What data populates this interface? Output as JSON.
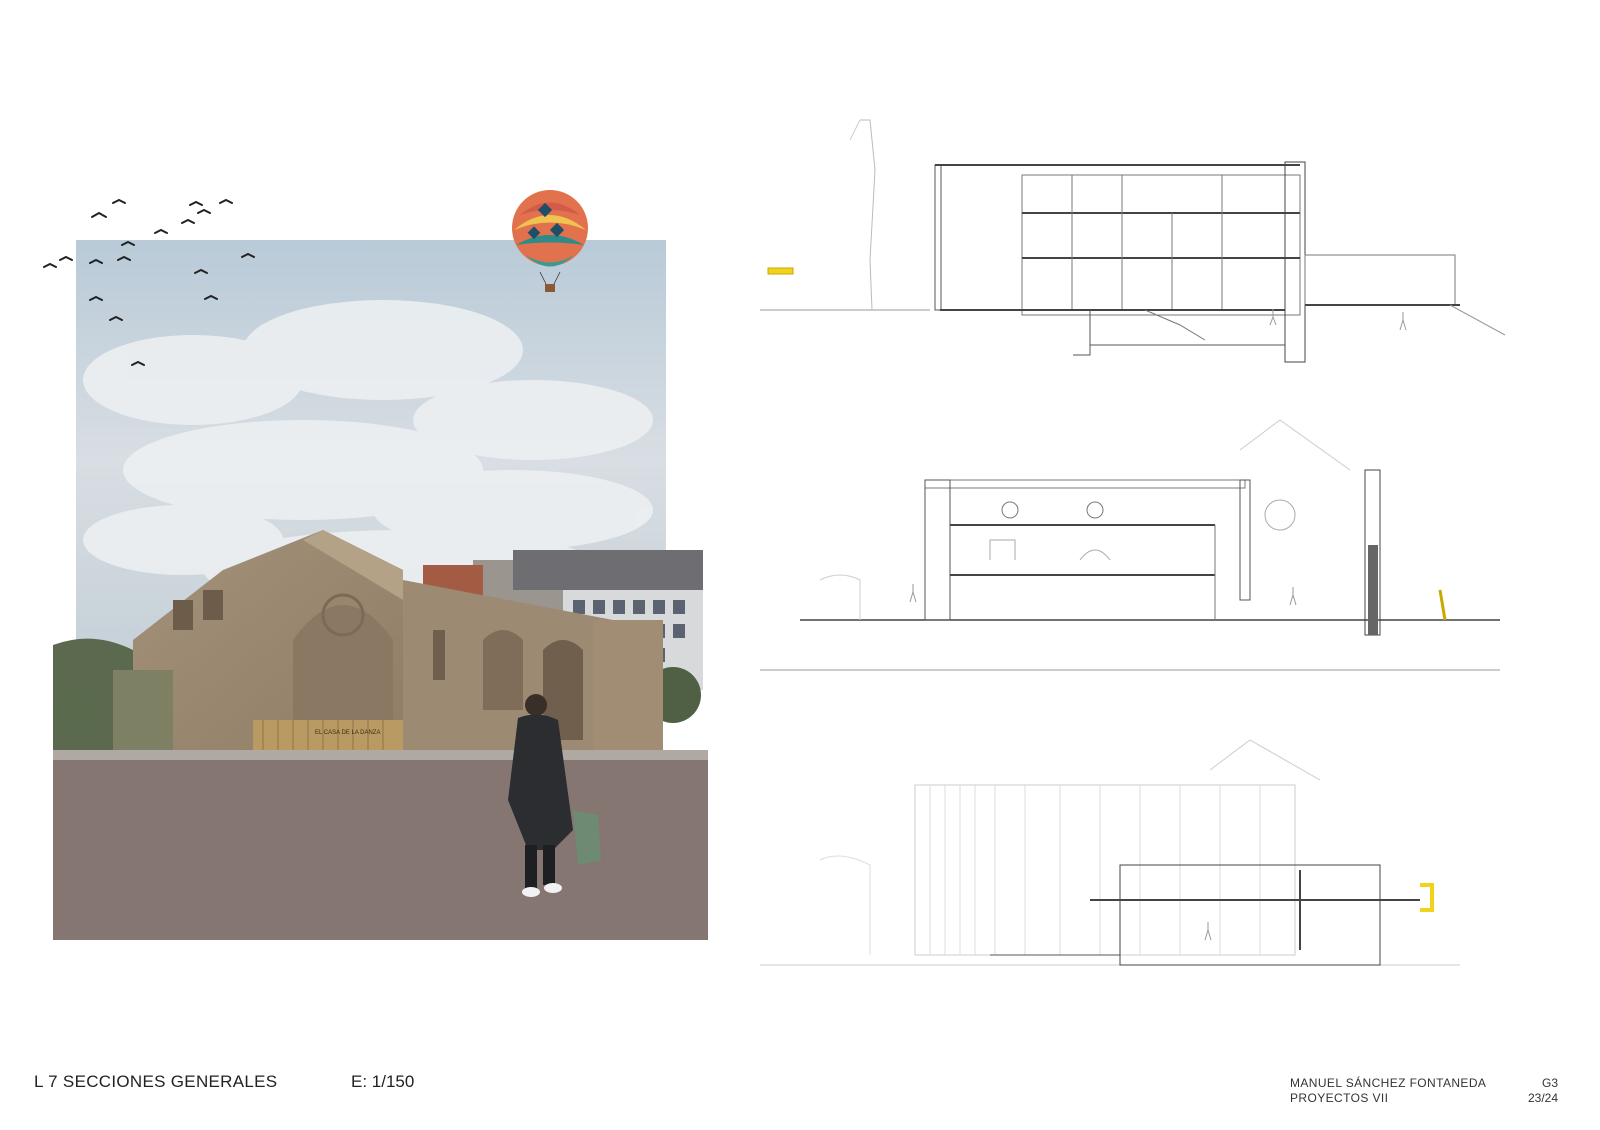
{
  "sheet": {
    "label": "L 7  SECCIONES GENERALES",
    "scale": "E: 1/150"
  },
  "author": {
    "name": "MANUEL SÁNCHEZ FONTANEDA",
    "course": "PROYECTOS VII"
  },
  "group": {
    "code": "G3",
    "year": "23/24"
  },
  "render": {
    "sign_text": "EL CASA DE LA DANZA"
  },
  "colors": {
    "accent_yellow": "#f2d21a",
    "ground": "#857672",
    "sky": "#c9d6df",
    "stone": "#a89477"
  }
}
